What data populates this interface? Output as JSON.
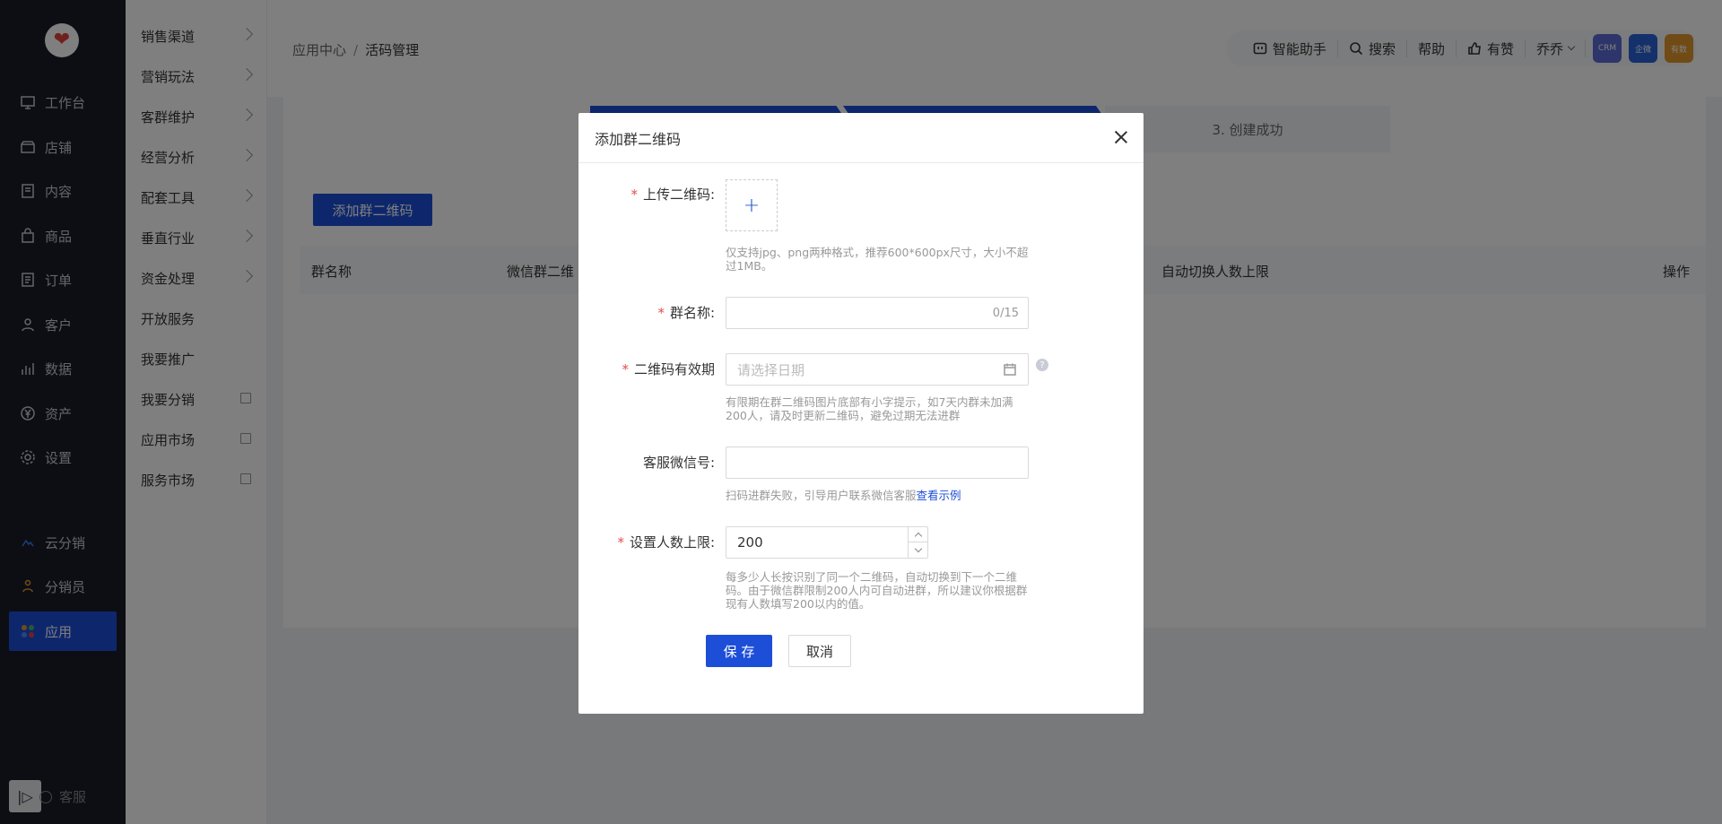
{
  "nav": {
    "items": [
      {
        "label": "工作台",
        "icon": "monitor-icon"
      },
      {
        "label": "店铺",
        "icon": "store-icon"
      },
      {
        "label": "内容",
        "icon": "document-icon"
      },
      {
        "label": "商品",
        "icon": "bag-icon"
      },
      {
        "label": "订单",
        "icon": "list-icon"
      },
      {
        "label": "客户",
        "icon": "user-icon"
      },
      {
        "label": "数据",
        "icon": "bar-chart-icon"
      },
      {
        "label": "资产",
        "icon": "yen-icon"
      },
      {
        "label": "设置",
        "icon": "gear-icon"
      }
    ],
    "extras": [
      {
        "label": "云分销",
        "icon": "cloud-icon"
      },
      {
        "label": "分销员",
        "icon": "people-icon"
      },
      {
        "label": "应用",
        "icon": "apps-icon"
      }
    ],
    "kefu": "客服"
  },
  "subnav": {
    "items": [
      {
        "label": "销售渠道"
      },
      {
        "label": "营销玩法"
      },
      {
        "label": "客群维护"
      },
      {
        "label": "经营分析"
      },
      {
        "label": "配套工具"
      },
      {
        "label": "垂直行业"
      },
      {
        "label": "资金处理"
      },
      {
        "label": "开放服务"
      },
      {
        "label": "我要推广"
      },
      {
        "label": "我要分销"
      },
      {
        "label": "应用市场"
      },
      {
        "label": "服务市场"
      }
    ]
  },
  "header": {
    "breadcrumb": {
      "parent": "应用中心",
      "sep": "/",
      "current": "活码管理"
    },
    "toolbar": {
      "assistant": "智能助手",
      "search": "搜索",
      "help": "帮助",
      "like": "有赞",
      "user": "乔乔",
      "apps": [
        {
          "label": "CRM",
          "color": "#5b6bd6"
        },
        {
          "label": "企微",
          "color": "#2a63d8"
        },
        {
          "label": "有数",
          "color": "#e2972a"
        }
      ]
    }
  },
  "page": {
    "steps": [
      "3. 创建成功"
    ],
    "add_button": "添加群二维码",
    "columns": [
      "群名称",
      "微信群二维",
      "自动切换人数上限",
      "操作"
    ]
  },
  "modal": {
    "title": "添加群二维码",
    "upload_label": "上传二维码:",
    "upload_hint": "仅支持jpg、png两种格式，推荐600*600px尺寸，大小不超过1MB。",
    "group_name_label": "群名称:",
    "group_name_value": "",
    "group_name_counter": "0/15",
    "expiry_label": "二维码有效期",
    "expiry_placeholder": "请选择日期",
    "expiry_hint": "有限期在群二维码图片底部有小字提示，如7天内群未加满200人，请及时更新二维码，避免过期无法进群",
    "wechat_label": "客服微信号:",
    "wechat_value": "",
    "wechat_hint": "扫码进群失败，引导用户联系微信客服",
    "wechat_hint_link": "查看示例",
    "limit_label": "设置人数上限:",
    "limit_value": "200",
    "limit_hint": "每多少人长按识别了同一个二维码，自动切换到下一个二维码。由于微信群限制200人内可自动进群，所以建议你根据群现有人数填写200以内的值。",
    "save": "保 存",
    "cancel": "取消"
  }
}
